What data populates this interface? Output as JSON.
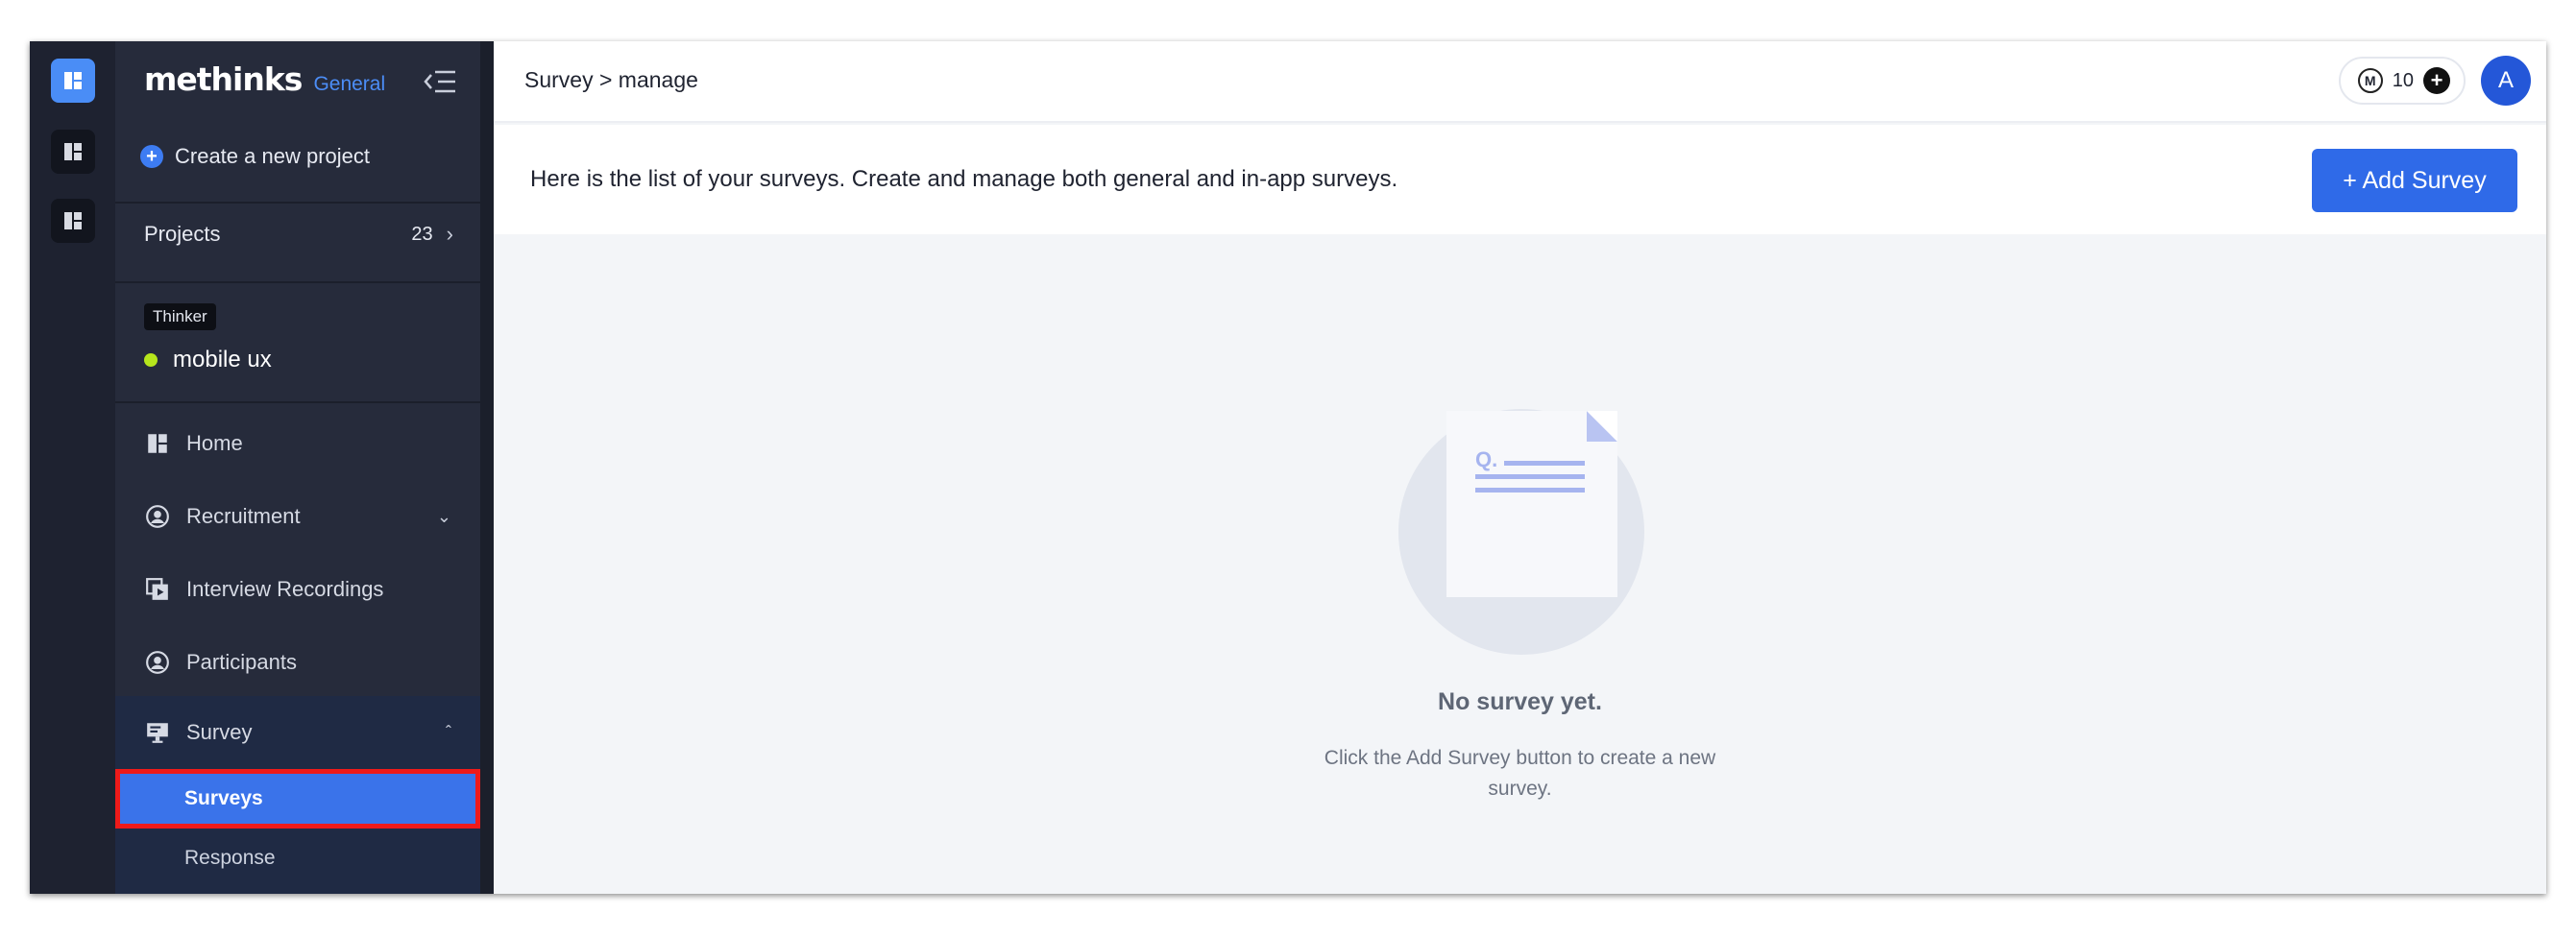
{
  "brand": {
    "name": "methinks",
    "tag": "General"
  },
  "sidebar": {
    "create_label": "Create a new project",
    "projects_label": "Projects",
    "projects_count": "23",
    "role_badge": "Thinker",
    "project_name": "mobile ux",
    "nav": [
      {
        "label": "Home",
        "icon": "dashboard-icon"
      },
      {
        "label": "Recruitment",
        "icon": "recruitment-icon"
      },
      {
        "label": "Interview Recordings",
        "icon": "video-library-icon"
      },
      {
        "label": "Participants",
        "icon": "participants-icon"
      },
      {
        "label": "Survey",
        "icon": "survey-icon"
      }
    ],
    "survey_sub": [
      {
        "label": "Surveys",
        "selected": true
      },
      {
        "label": "Response",
        "selected": false
      }
    ]
  },
  "header": {
    "breadcrumb": "Survey > manage",
    "credits": "10",
    "avatar_initial": "A"
  },
  "info": {
    "text": "Here is the list of your surveys. Create and manage both general and in-app surveys.",
    "add_button": "+ Add Survey"
  },
  "empty_state": {
    "title": "No survey yet.",
    "description": "Click the Add Survey button to create a new survey.",
    "illustration_mark": "Q."
  },
  "colors": {
    "accent": "#2f6ae8",
    "sidebar_bg": "#262b3b",
    "rail_bg": "#1e2230",
    "status_online": "#b6e61c",
    "selection_outline": "#ee1a1a"
  }
}
